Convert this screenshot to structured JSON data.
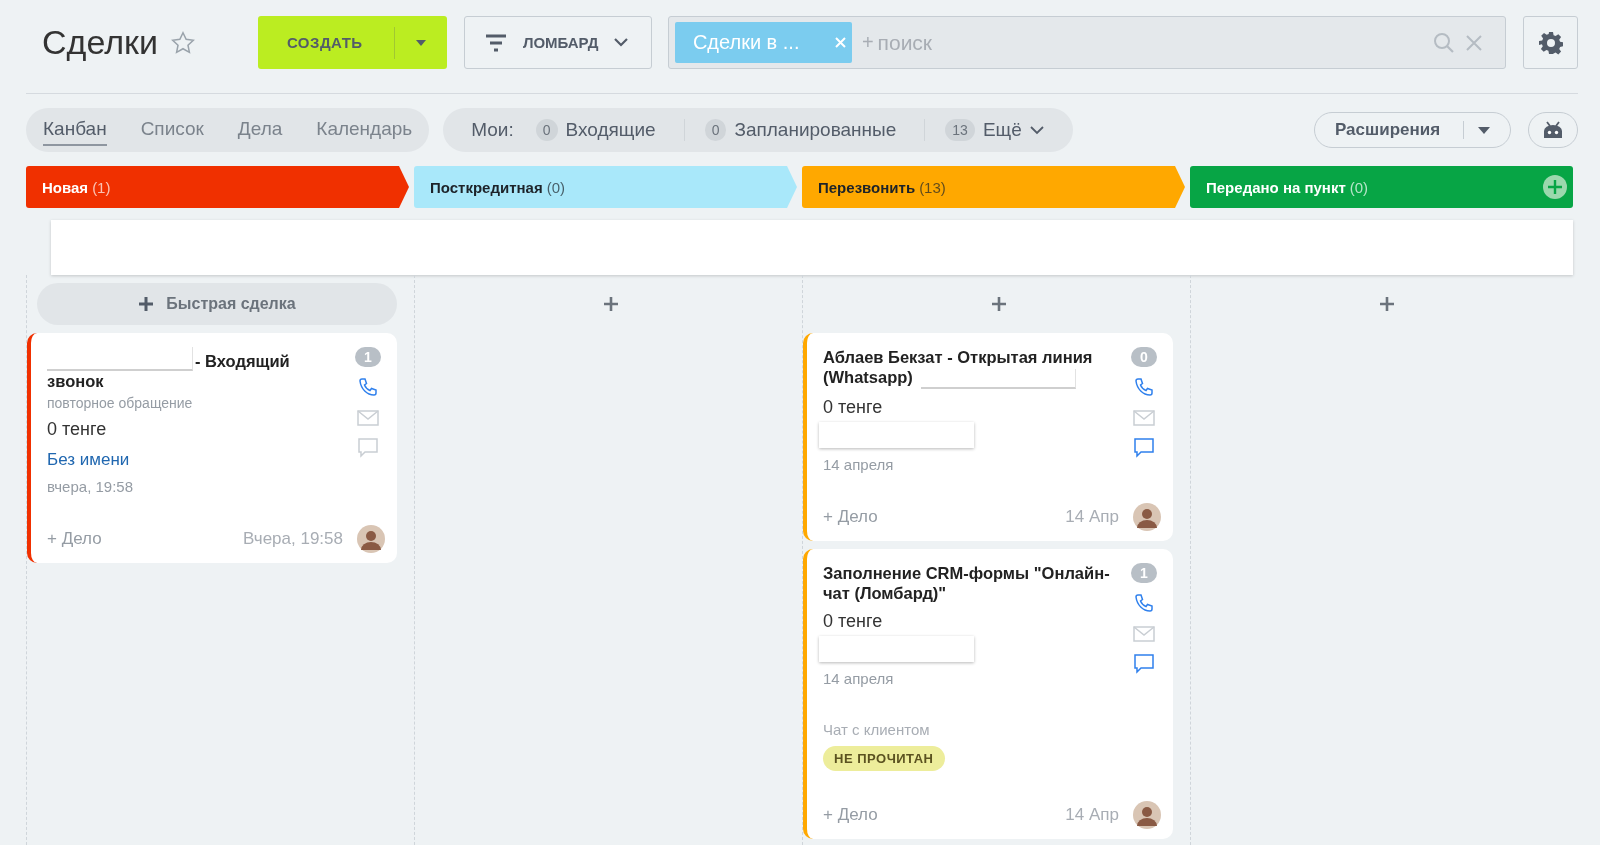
{
  "title": "Сделки",
  "create_button": {
    "label": "СОЗДАТЬ"
  },
  "filter_button": {
    "label": "ЛОМБАРД"
  },
  "search": {
    "tag": "Сделки в ...",
    "prefix": "+",
    "placeholder": "поиск"
  },
  "view_tabs": [
    {
      "label": "Канбан",
      "selected": true
    },
    {
      "label": "Список",
      "selected": false
    },
    {
      "label": "Дела",
      "selected": false
    },
    {
      "label": "Календарь",
      "selected": false
    }
  ],
  "counters": {
    "label": "Мои:",
    "items": [
      {
        "count": "0",
        "label": "Входящие",
        "kind": "plain"
      },
      {
        "count": "0",
        "label": "Запланированные",
        "kind": "plain"
      },
      {
        "count": "13",
        "label": "Ещё",
        "kind": "dropdown"
      }
    ]
  },
  "extensions_button": {
    "label": "Расширения"
  },
  "stages": [
    {
      "name": "Новая",
      "count": "(1)",
      "color": "#f03000"
    },
    {
      "name": "Посткредитная",
      "count": "(0)",
      "color": "#a9e8fa"
    },
    {
      "name": "Перезвонить",
      "count": "(13)",
      "color": "#ffa800"
    },
    {
      "name": "Передано на пункт",
      "count": "(0)",
      "color": "#07a545"
    }
  ],
  "columns": [
    {
      "quick_add": "Быстрая сделка",
      "cards": [
        {
          "title": "- Входящий звонок",
          "masked_start": true,
          "masked_end": false,
          "subtitle": "повторное обращение",
          "amount": "0 тенге",
          "contact": {
            "name": "Без имени"
          },
          "date": "вчера, 19:58",
          "counter": "1",
          "chat_active": false,
          "footer_action": "+ Дело",
          "footer_date": "Вчера, 19:58"
        }
      ]
    },
    {},
    {
      "cards": [
        {
          "title": "Аблаев Бекзат - Открытая линия (Whatsapp)",
          "masked_start": false,
          "masked_end": true,
          "amount": "0 тенге",
          "contact": {
            "redacted": true
          },
          "date": "14 апреля",
          "counter": "0",
          "chat_active": true,
          "footer_action": "+ Дело",
          "footer_date": "14 Апр"
        },
        {
          "title": "Заполнение CRM-формы \"Онлайн-чат (Ломбард)\"",
          "masked_start": false,
          "masked_end": false,
          "amount": "0 тенге",
          "contact": {
            "redacted": true
          },
          "date": "14 апреля",
          "source": "Чат с клиентом",
          "badge": "НЕ ПРОЧИТАН",
          "counter": "1",
          "chat_active": true,
          "footer_action": "+ Дело",
          "footer_date": "14 Апр"
        }
      ]
    },
    {}
  ]
}
